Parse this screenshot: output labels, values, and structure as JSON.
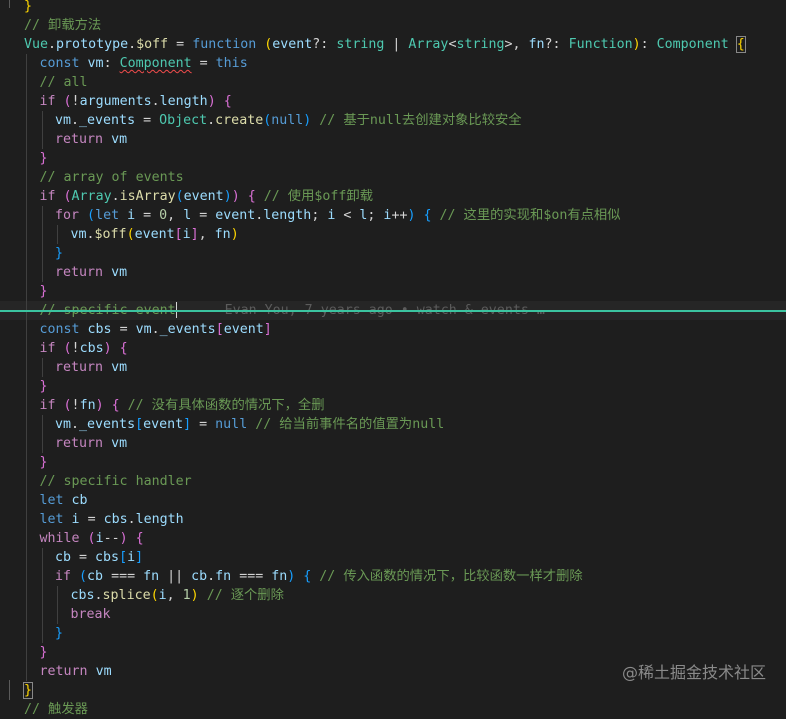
{
  "lines": [
    {
      "indent": 0,
      "segments": [
        {
          "t": "}",
          "c": "t-b1"
        }
      ]
    },
    {
      "indent": 0,
      "segments": [
        {
          "t": "// 卸载方法",
          "c": "t-com"
        }
      ]
    },
    {
      "indent": 0,
      "segments": [
        {
          "t": "Vue",
          "c": "t-type"
        },
        {
          "t": ".",
          "c": "t-op"
        },
        {
          "t": "prototype",
          "c": "t-var"
        },
        {
          "t": ".",
          "c": "t-op"
        },
        {
          "t": "$off",
          "c": "t-fn"
        },
        {
          "t": " = ",
          "c": "t-op"
        },
        {
          "t": "function",
          "c": "t-kw"
        },
        {
          "t": " ",
          "c": "t-op"
        },
        {
          "t": "(",
          "c": "t-b1"
        },
        {
          "t": "event",
          "c": "t-var"
        },
        {
          "t": "?: ",
          "c": "t-op"
        },
        {
          "t": "string",
          "c": "t-type"
        },
        {
          "t": " | ",
          "c": "t-op"
        },
        {
          "t": "Array",
          "c": "t-type"
        },
        {
          "t": "<",
          "c": "t-op"
        },
        {
          "t": "string",
          "c": "t-type"
        },
        {
          "t": ">, ",
          "c": "t-op"
        },
        {
          "t": "fn",
          "c": "t-var"
        },
        {
          "t": "?: ",
          "c": "t-op"
        },
        {
          "t": "Function",
          "c": "t-type"
        },
        {
          "t": ")",
          "c": "t-b1"
        },
        {
          "t": ": ",
          "c": "t-op"
        },
        {
          "t": "Component",
          "c": "t-type"
        },
        {
          "t": " ",
          "c": "t-op"
        },
        {
          "t": "{",
          "c": "t-b1 sel-bracket"
        }
      ]
    },
    {
      "indent": 1,
      "segments": [
        {
          "t": "const",
          "c": "t-kw"
        },
        {
          "t": " ",
          "c": "t-op"
        },
        {
          "t": "vm",
          "c": "t-var"
        },
        {
          "t": ": ",
          "c": "t-op"
        },
        {
          "t": "Component",
          "c": "t-type squig"
        },
        {
          "t": " = ",
          "c": "t-op"
        },
        {
          "t": "this",
          "c": "t-kw"
        }
      ]
    },
    {
      "indent": 1,
      "segments": [
        {
          "t": "// all",
          "c": "t-com"
        }
      ]
    },
    {
      "indent": 1,
      "segments": [
        {
          "t": "if",
          "c": "t-ctrl"
        },
        {
          "t": " ",
          "c": "t-op"
        },
        {
          "t": "(",
          "c": "t-b2"
        },
        {
          "t": "!",
          "c": "t-op"
        },
        {
          "t": "arguments",
          "c": "t-var"
        },
        {
          "t": ".",
          "c": "t-op"
        },
        {
          "t": "length",
          "c": "t-var"
        },
        {
          "t": ")",
          "c": "t-b2"
        },
        {
          "t": " ",
          "c": "t-op"
        },
        {
          "t": "{",
          "c": "t-b2"
        }
      ]
    },
    {
      "indent": 2,
      "segments": [
        {
          "t": "vm",
          "c": "t-var"
        },
        {
          "t": ".",
          "c": "t-op"
        },
        {
          "t": "_events",
          "c": "t-var"
        },
        {
          "t": " = ",
          "c": "t-op"
        },
        {
          "t": "Object",
          "c": "t-type"
        },
        {
          "t": ".",
          "c": "t-op"
        },
        {
          "t": "create",
          "c": "t-fn"
        },
        {
          "t": "(",
          "c": "t-b3"
        },
        {
          "t": "null",
          "c": "t-kw"
        },
        {
          "t": ")",
          "c": "t-b3"
        },
        {
          "t": " ",
          "c": "t-op"
        },
        {
          "t": "// 基于null去创建对象比较安全",
          "c": "t-com"
        }
      ]
    },
    {
      "indent": 2,
      "segments": [
        {
          "t": "return",
          "c": "t-ctrl"
        },
        {
          "t": " ",
          "c": "t-op"
        },
        {
          "t": "vm",
          "c": "t-var"
        }
      ]
    },
    {
      "indent": 1,
      "segments": [
        {
          "t": "}",
          "c": "t-b2"
        }
      ]
    },
    {
      "indent": 1,
      "segments": [
        {
          "t": "// array of events",
          "c": "t-com"
        }
      ]
    },
    {
      "indent": 1,
      "segments": [
        {
          "t": "if",
          "c": "t-ctrl"
        },
        {
          "t": " ",
          "c": "t-op"
        },
        {
          "t": "(",
          "c": "t-b2"
        },
        {
          "t": "Array",
          "c": "t-type"
        },
        {
          "t": ".",
          "c": "t-op"
        },
        {
          "t": "isArray",
          "c": "t-fn"
        },
        {
          "t": "(",
          "c": "t-b3"
        },
        {
          "t": "event",
          "c": "t-var"
        },
        {
          "t": ")",
          "c": "t-b3"
        },
        {
          "t": ")",
          "c": "t-b2"
        },
        {
          "t": " ",
          "c": "t-op"
        },
        {
          "t": "{",
          "c": "t-b2"
        },
        {
          "t": " ",
          "c": "t-op"
        },
        {
          "t": "// 使用$off卸载",
          "c": "t-com"
        }
      ]
    },
    {
      "indent": 2,
      "segments": [
        {
          "t": "for",
          "c": "t-ctrl"
        },
        {
          "t": " ",
          "c": "t-op"
        },
        {
          "t": "(",
          "c": "t-b3"
        },
        {
          "t": "let",
          "c": "t-kw"
        },
        {
          "t": " ",
          "c": "t-op"
        },
        {
          "t": "i",
          "c": "t-var"
        },
        {
          "t": " = ",
          "c": "t-op"
        },
        {
          "t": "0",
          "c": "t-num"
        },
        {
          "t": ", ",
          "c": "t-op"
        },
        {
          "t": "l",
          "c": "t-var"
        },
        {
          "t": " = ",
          "c": "t-op"
        },
        {
          "t": "event",
          "c": "t-var"
        },
        {
          "t": ".",
          "c": "t-op"
        },
        {
          "t": "length",
          "c": "t-var"
        },
        {
          "t": "; ",
          "c": "t-op"
        },
        {
          "t": "i",
          "c": "t-var"
        },
        {
          "t": " < ",
          "c": "t-op"
        },
        {
          "t": "l",
          "c": "t-var"
        },
        {
          "t": "; ",
          "c": "t-op"
        },
        {
          "t": "i",
          "c": "t-var"
        },
        {
          "t": "++",
          "c": "t-op"
        },
        {
          "t": ")",
          "c": "t-b3"
        },
        {
          "t": " ",
          "c": "t-op"
        },
        {
          "t": "{",
          "c": "t-b3"
        },
        {
          "t": " ",
          "c": "t-op"
        },
        {
          "t": "// 这里的实现和$on有点相似",
          "c": "t-com"
        }
      ]
    },
    {
      "indent": 3,
      "segments": [
        {
          "t": "vm",
          "c": "t-var"
        },
        {
          "t": ".",
          "c": "t-op"
        },
        {
          "t": "$off",
          "c": "t-fn"
        },
        {
          "t": "(",
          "c": "t-b1"
        },
        {
          "t": "event",
          "c": "t-var"
        },
        {
          "t": "[",
          "c": "t-b2"
        },
        {
          "t": "i",
          "c": "t-var"
        },
        {
          "t": "]",
          "c": "t-b2"
        },
        {
          "t": ", ",
          "c": "t-op"
        },
        {
          "t": "fn",
          "c": "t-var"
        },
        {
          "t": ")",
          "c": "t-b1"
        }
      ]
    },
    {
      "indent": 2,
      "segments": [
        {
          "t": "}",
          "c": "t-b3"
        }
      ]
    },
    {
      "indent": 2,
      "segments": [
        {
          "t": "return",
          "c": "t-ctrl"
        },
        {
          "t": " ",
          "c": "t-op"
        },
        {
          "t": "vm",
          "c": "t-var"
        }
      ]
    },
    {
      "indent": 1,
      "segments": [
        {
          "t": "}",
          "c": "t-b2"
        }
      ]
    },
    {
      "indent": 1,
      "cursor": true,
      "segments": [
        {
          "t": "// specific event",
          "c": "t-com"
        }
      ],
      "blame": "Evan You, 7 years ago • watch & events …"
    },
    {
      "indent": 1,
      "segments": [
        {
          "t": "const",
          "c": "t-kw"
        },
        {
          "t": " ",
          "c": "t-op"
        },
        {
          "t": "cbs",
          "c": "t-var"
        },
        {
          "t": " = ",
          "c": "t-op"
        },
        {
          "t": "vm",
          "c": "t-var"
        },
        {
          "t": ".",
          "c": "t-op"
        },
        {
          "t": "_events",
          "c": "t-var"
        },
        {
          "t": "[",
          "c": "t-b2"
        },
        {
          "t": "event",
          "c": "t-var"
        },
        {
          "t": "]",
          "c": "t-b2"
        }
      ]
    },
    {
      "indent": 1,
      "segments": [
        {
          "t": "if",
          "c": "t-ctrl"
        },
        {
          "t": " ",
          "c": "t-op"
        },
        {
          "t": "(",
          "c": "t-b2"
        },
        {
          "t": "!",
          "c": "t-op"
        },
        {
          "t": "cbs",
          "c": "t-var"
        },
        {
          "t": ")",
          "c": "t-b2"
        },
        {
          "t": " ",
          "c": "t-op"
        },
        {
          "t": "{",
          "c": "t-b2"
        }
      ]
    },
    {
      "indent": 2,
      "segments": [
        {
          "t": "return",
          "c": "t-ctrl"
        },
        {
          "t": " ",
          "c": "t-op"
        },
        {
          "t": "vm",
          "c": "t-var"
        }
      ]
    },
    {
      "indent": 1,
      "segments": [
        {
          "t": "}",
          "c": "t-b2"
        }
      ]
    },
    {
      "indent": 1,
      "segments": [
        {
          "t": "if",
          "c": "t-ctrl"
        },
        {
          "t": " ",
          "c": "t-op"
        },
        {
          "t": "(",
          "c": "t-b2"
        },
        {
          "t": "!",
          "c": "t-op"
        },
        {
          "t": "fn",
          "c": "t-var"
        },
        {
          "t": ")",
          "c": "t-b2"
        },
        {
          "t": " ",
          "c": "t-op"
        },
        {
          "t": "{",
          "c": "t-b2"
        },
        {
          "t": " ",
          "c": "t-op"
        },
        {
          "t": "// 没有具体函数的情况下，全删",
          "c": "t-com"
        }
      ]
    },
    {
      "indent": 2,
      "segments": [
        {
          "t": "vm",
          "c": "t-var"
        },
        {
          "t": ".",
          "c": "t-op"
        },
        {
          "t": "_events",
          "c": "t-var"
        },
        {
          "t": "[",
          "c": "t-b3"
        },
        {
          "t": "event",
          "c": "t-var"
        },
        {
          "t": "]",
          "c": "t-b3"
        },
        {
          "t": " = ",
          "c": "t-op"
        },
        {
          "t": "null",
          "c": "t-kw"
        },
        {
          "t": " ",
          "c": "t-op"
        },
        {
          "t": "// 给当前事件名的值置为null",
          "c": "t-com"
        }
      ]
    },
    {
      "indent": 2,
      "segments": [
        {
          "t": "return",
          "c": "t-ctrl"
        },
        {
          "t": " ",
          "c": "t-op"
        },
        {
          "t": "vm",
          "c": "t-var"
        }
      ]
    },
    {
      "indent": 1,
      "segments": [
        {
          "t": "}",
          "c": "t-b2"
        }
      ]
    },
    {
      "indent": 1,
      "segments": [
        {
          "t": "// specific handler",
          "c": "t-com"
        }
      ]
    },
    {
      "indent": 1,
      "segments": [
        {
          "t": "let",
          "c": "t-kw"
        },
        {
          "t": " ",
          "c": "t-op"
        },
        {
          "t": "cb",
          "c": "t-var"
        }
      ]
    },
    {
      "indent": 1,
      "segments": [
        {
          "t": "let",
          "c": "t-kw"
        },
        {
          "t": " ",
          "c": "t-op"
        },
        {
          "t": "i",
          "c": "t-var"
        },
        {
          "t": " = ",
          "c": "t-op"
        },
        {
          "t": "cbs",
          "c": "t-var"
        },
        {
          "t": ".",
          "c": "t-op"
        },
        {
          "t": "length",
          "c": "t-var"
        }
      ]
    },
    {
      "indent": 1,
      "segments": [
        {
          "t": "while",
          "c": "t-ctrl"
        },
        {
          "t": " ",
          "c": "t-op"
        },
        {
          "t": "(",
          "c": "t-b2"
        },
        {
          "t": "i",
          "c": "t-var"
        },
        {
          "t": "--",
          "c": "t-op"
        },
        {
          "t": ")",
          "c": "t-b2"
        },
        {
          "t": " ",
          "c": "t-op"
        },
        {
          "t": "{",
          "c": "t-b2"
        }
      ]
    },
    {
      "indent": 2,
      "segments": [
        {
          "t": "cb",
          "c": "t-var"
        },
        {
          "t": " = ",
          "c": "t-op"
        },
        {
          "t": "cbs",
          "c": "t-var"
        },
        {
          "t": "[",
          "c": "t-b3"
        },
        {
          "t": "i",
          "c": "t-var"
        },
        {
          "t": "]",
          "c": "t-b3"
        }
      ]
    },
    {
      "indent": 2,
      "segments": [
        {
          "t": "if",
          "c": "t-ctrl"
        },
        {
          "t": " ",
          "c": "t-op"
        },
        {
          "t": "(",
          "c": "t-b3"
        },
        {
          "t": "cb",
          "c": "t-var"
        },
        {
          "t": " === ",
          "c": "t-op"
        },
        {
          "t": "fn",
          "c": "t-var"
        },
        {
          "t": " || ",
          "c": "t-op"
        },
        {
          "t": "cb",
          "c": "t-var"
        },
        {
          "t": ".",
          "c": "t-op"
        },
        {
          "t": "fn",
          "c": "t-var"
        },
        {
          "t": " === ",
          "c": "t-op"
        },
        {
          "t": "fn",
          "c": "t-var"
        },
        {
          "t": ")",
          "c": "t-b3"
        },
        {
          "t": " ",
          "c": "t-op"
        },
        {
          "t": "{",
          "c": "t-b3"
        },
        {
          "t": " ",
          "c": "t-op"
        },
        {
          "t": "// 传入函数的情况下，比较函数一样才删除",
          "c": "t-com"
        }
      ]
    },
    {
      "indent": 3,
      "segments": [
        {
          "t": "cbs",
          "c": "t-var"
        },
        {
          "t": ".",
          "c": "t-op"
        },
        {
          "t": "splice",
          "c": "t-fn"
        },
        {
          "t": "(",
          "c": "t-b1"
        },
        {
          "t": "i",
          "c": "t-var"
        },
        {
          "t": ", ",
          "c": "t-op"
        },
        {
          "t": "1",
          "c": "t-num"
        },
        {
          "t": ")",
          "c": "t-b1"
        },
        {
          "t": " ",
          "c": "t-op"
        },
        {
          "t": "// 逐个删除",
          "c": "t-com"
        }
      ]
    },
    {
      "indent": 3,
      "segments": [
        {
          "t": "break",
          "c": "t-ctrl"
        }
      ]
    },
    {
      "indent": 2,
      "segments": [
        {
          "t": "}",
          "c": "t-b3"
        }
      ]
    },
    {
      "indent": 1,
      "segments": [
        {
          "t": "}",
          "c": "t-b2"
        }
      ]
    },
    {
      "indent": 1,
      "segments": [
        {
          "t": "return",
          "c": "t-ctrl"
        },
        {
          "t": " ",
          "c": "t-op"
        },
        {
          "t": "vm",
          "c": "t-var"
        }
      ]
    },
    {
      "indent": 0,
      "segments": [
        {
          "t": "}",
          "c": "t-b1 sel-bracket"
        }
      ]
    },
    {
      "indent": 0,
      "segments": [
        {
          "t": "// 触发器",
          "c": "t-com"
        }
      ]
    }
  ],
  "watermark": "@稀土掘金技术社区"
}
